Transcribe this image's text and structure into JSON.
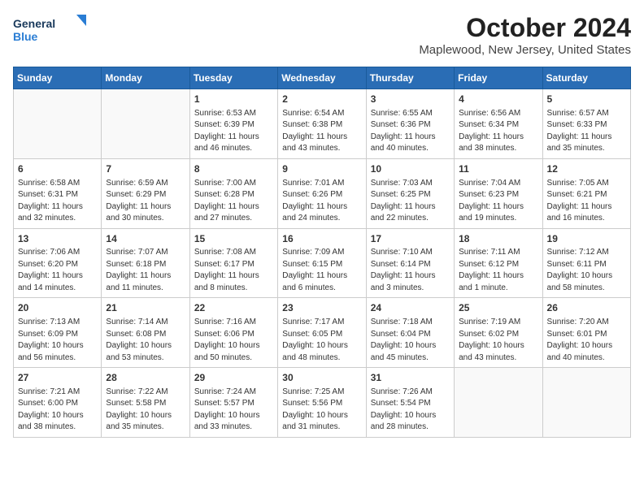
{
  "header": {
    "logo_general": "General",
    "logo_blue": "Blue",
    "title": "October 2024",
    "subtitle": "Maplewood, New Jersey, United States"
  },
  "calendar": {
    "days_of_week": [
      "Sunday",
      "Monday",
      "Tuesday",
      "Wednesday",
      "Thursday",
      "Friday",
      "Saturday"
    ],
    "weeks": [
      [
        {
          "day": "",
          "content": ""
        },
        {
          "day": "",
          "content": ""
        },
        {
          "day": "1",
          "content": "Sunrise: 6:53 AM\nSunset: 6:39 PM\nDaylight: 11 hours\nand 46 minutes."
        },
        {
          "day": "2",
          "content": "Sunrise: 6:54 AM\nSunset: 6:38 PM\nDaylight: 11 hours\nand 43 minutes."
        },
        {
          "day": "3",
          "content": "Sunrise: 6:55 AM\nSunset: 6:36 PM\nDaylight: 11 hours\nand 40 minutes."
        },
        {
          "day": "4",
          "content": "Sunrise: 6:56 AM\nSunset: 6:34 PM\nDaylight: 11 hours\nand 38 minutes."
        },
        {
          "day": "5",
          "content": "Sunrise: 6:57 AM\nSunset: 6:33 PM\nDaylight: 11 hours\nand 35 minutes."
        }
      ],
      [
        {
          "day": "6",
          "content": "Sunrise: 6:58 AM\nSunset: 6:31 PM\nDaylight: 11 hours\nand 32 minutes."
        },
        {
          "day": "7",
          "content": "Sunrise: 6:59 AM\nSunset: 6:29 PM\nDaylight: 11 hours\nand 30 minutes."
        },
        {
          "day": "8",
          "content": "Sunrise: 7:00 AM\nSunset: 6:28 PM\nDaylight: 11 hours\nand 27 minutes."
        },
        {
          "day": "9",
          "content": "Sunrise: 7:01 AM\nSunset: 6:26 PM\nDaylight: 11 hours\nand 24 minutes."
        },
        {
          "day": "10",
          "content": "Sunrise: 7:03 AM\nSunset: 6:25 PM\nDaylight: 11 hours\nand 22 minutes."
        },
        {
          "day": "11",
          "content": "Sunrise: 7:04 AM\nSunset: 6:23 PM\nDaylight: 11 hours\nand 19 minutes."
        },
        {
          "day": "12",
          "content": "Sunrise: 7:05 AM\nSunset: 6:21 PM\nDaylight: 11 hours\nand 16 minutes."
        }
      ],
      [
        {
          "day": "13",
          "content": "Sunrise: 7:06 AM\nSunset: 6:20 PM\nDaylight: 11 hours\nand 14 minutes."
        },
        {
          "day": "14",
          "content": "Sunrise: 7:07 AM\nSunset: 6:18 PM\nDaylight: 11 hours\nand 11 minutes."
        },
        {
          "day": "15",
          "content": "Sunrise: 7:08 AM\nSunset: 6:17 PM\nDaylight: 11 hours\nand 8 minutes."
        },
        {
          "day": "16",
          "content": "Sunrise: 7:09 AM\nSunset: 6:15 PM\nDaylight: 11 hours\nand 6 minutes."
        },
        {
          "day": "17",
          "content": "Sunrise: 7:10 AM\nSunset: 6:14 PM\nDaylight: 11 hours\nand 3 minutes."
        },
        {
          "day": "18",
          "content": "Sunrise: 7:11 AM\nSunset: 6:12 PM\nDaylight: 11 hours\nand 1 minute."
        },
        {
          "day": "19",
          "content": "Sunrise: 7:12 AM\nSunset: 6:11 PM\nDaylight: 10 hours\nand 58 minutes."
        }
      ],
      [
        {
          "day": "20",
          "content": "Sunrise: 7:13 AM\nSunset: 6:09 PM\nDaylight: 10 hours\nand 56 minutes."
        },
        {
          "day": "21",
          "content": "Sunrise: 7:14 AM\nSunset: 6:08 PM\nDaylight: 10 hours\nand 53 minutes."
        },
        {
          "day": "22",
          "content": "Sunrise: 7:16 AM\nSunset: 6:06 PM\nDaylight: 10 hours\nand 50 minutes."
        },
        {
          "day": "23",
          "content": "Sunrise: 7:17 AM\nSunset: 6:05 PM\nDaylight: 10 hours\nand 48 minutes."
        },
        {
          "day": "24",
          "content": "Sunrise: 7:18 AM\nSunset: 6:04 PM\nDaylight: 10 hours\nand 45 minutes."
        },
        {
          "day": "25",
          "content": "Sunrise: 7:19 AM\nSunset: 6:02 PM\nDaylight: 10 hours\nand 43 minutes."
        },
        {
          "day": "26",
          "content": "Sunrise: 7:20 AM\nSunset: 6:01 PM\nDaylight: 10 hours\nand 40 minutes."
        }
      ],
      [
        {
          "day": "27",
          "content": "Sunrise: 7:21 AM\nSunset: 6:00 PM\nDaylight: 10 hours\nand 38 minutes."
        },
        {
          "day": "28",
          "content": "Sunrise: 7:22 AM\nSunset: 5:58 PM\nDaylight: 10 hours\nand 35 minutes."
        },
        {
          "day": "29",
          "content": "Sunrise: 7:24 AM\nSunset: 5:57 PM\nDaylight: 10 hours\nand 33 minutes."
        },
        {
          "day": "30",
          "content": "Sunrise: 7:25 AM\nSunset: 5:56 PM\nDaylight: 10 hours\nand 31 minutes."
        },
        {
          "day": "31",
          "content": "Sunrise: 7:26 AM\nSunset: 5:54 PM\nDaylight: 10 hours\nand 28 minutes."
        },
        {
          "day": "",
          "content": ""
        },
        {
          "day": "",
          "content": ""
        }
      ]
    ]
  }
}
